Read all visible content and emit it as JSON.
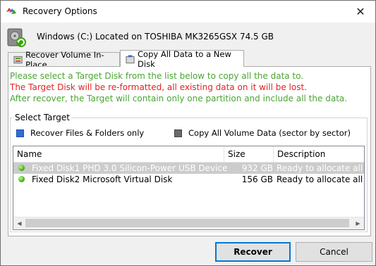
{
  "window": {
    "title": "Recovery Options",
    "close_glyph": "✕"
  },
  "drive": {
    "label": "Windows (C:) Located on TOSHIBA MK3265GSX 74.5 GB"
  },
  "tabs": [
    {
      "label": "Recover Volume In-Place",
      "active": false
    },
    {
      "label": "Copy All Data to a New Disk",
      "active": true
    }
  ],
  "messages": {
    "line1": "Please select a Target Disk from the list below to copy all the data to.",
    "line2": "The Target Disk will be re-formatted, all existing data on it will be lost.",
    "line3": "After recover, the Target will contain only one partition and include all the data."
  },
  "select_target": {
    "label": "Select Target",
    "options": [
      {
        "label": "Recover Files & Folders only",
        "selected": true
      },
      {
        "label": "Copy All Volume Data (sector by sector)",
        "selected": false
      }
    ]
  },
  "disk_list": {
    "columns": {
      "name": "Name",
      "size": "Size",
      "description": "Description"
    },
    "rows": [
      {
        "name": "Fixed Disk1 PHD 3.0 Silicon-Power USB Device",
        "size": "932 GB",
        "description": "Ready to allocate all volume data",
        "selected": true
      },
      {
        "name": "Fixed Disk2 Microsoft Virtual Disk",
        "size": "156 GB",
        "description": "Ready to allocate all volume data",
        "selected": false
      }
    ]
  },
  "buttons": {
    "recover": "Recover",
    "cancel": "Cancel"
  },
  "colors": {
    "info_green": "#4aa532",
    "warning_red": "#e32222",
    "accent_blue": "#0078d7"
  }
}
